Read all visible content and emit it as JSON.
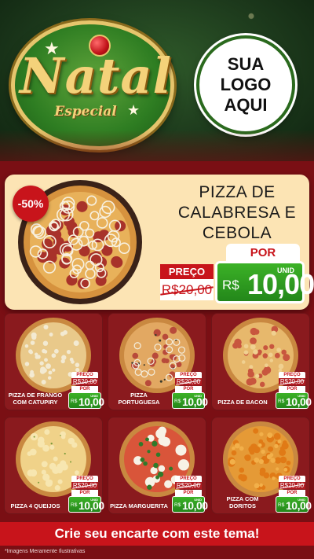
{
  "header": {
    "badge_title": "Natal",
    "badge_subtitle": "Especial",
    "logo_lines": [
      "SUA",
      "LOGO",
      "AQUI"
    ]
  },
  "featured": {
    "discount": "-50%",
    "title_lines": [
      "PIZZA DE",
      "CALABRESA E",
      "CEBOLA"
    ],
    "preco_label": "PREÇO",
    "old_price": "R$20,00",
    "por_label": "POR",
    "unit_label": "UNID",
    "currency": "R$",
    "new_price": "10,00"
  },
  "products": [
    {
      "name": "PIZZA DE FRANGO COM CATUPIRY",
      "preco_label": "PREÇO",
      "old_price": "R$20,00",
      "por_label": "POR",
      "unit_label": "UNID",
      "currency": "R$",
      "new_price": "10,00",
      "style": "frango"
    },
    {
      "name": "PIZZA PORTUGUESA",
      "preco_label": "PREÇO",
      "old_price": "R$20,00",
      "por_label": "POR",
      "unit_label": "UNID",
      "currency": "R$",
      "new_price": "10,00",
      "style": "portuguesa"
    },
    {
      "name": "PIZZA DE BACON",
      "preco_label": "PREÇO",
      "old_price": "R$20,00",
      "por_label": "POR",
      "unit_label": "UNID",
      "currency": "R$",
      "new_price": "10,00",
      "style": "bacon"
    },
    {
      "name": "PIZZA 4 QUEIJOS",
      "preco_label": "PREÇO",
      "old_price": "R$20,00",
      "por_label": "POR",
      "unit_label": "UNID",
      "currency": "R$",
      "new_price": "10,00",
      "style": "queijo"
    },
    {
      "name": "PIZZA MARGUERITA",
      "preco_label": "PREÇO",
      "old_price": "R$20,00",
      "por_label": "POR",
      "unit_label": "UNID",
      "currency": "R$",
      "new_price": "10,00",
      "style": "marguerita"
    },
    {
      "name": "PIZZA COM DORITOS",
      "preco_label": "PREÇO",
      "old_price": "R$20,00",
      "por_label": "POR",
      "unit_label": "UNID",
      "currency": "R$",
      "new_price": "10,00",
      "style": "doritos"
    }
  ],
  "footer": {
    "cta": "Crie seu encarte com este tema!",
    "disclaimer": "*Imagens Meramente Ilustrativas"
  },
  "colors": {
    "brand_red": "#c8141b",
    "price_green": "#2ea122",
    "background_red": "#7a0f14",
    "header_green": "#1d3a1c",
    "gold": "#f4d27a",
    "cream": "#fce4b4"
  }
}
